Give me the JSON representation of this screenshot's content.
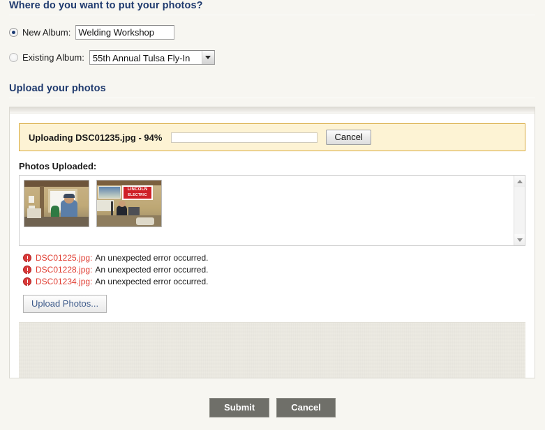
{
  "destination": {
    "heading": "Where do you want to put your photos?",
    "new_album": {
      "label": "New Album:",
      "selected": true,
      "value": "Welding Workshop",
      "placeholder": ""
    },
    "existing_album": {
      "label": "Existing Album:",
      "selected": false,
      "selected_option": "55th Annual Tulsa Fly-In"
    }
  },
  "upload": {
    "heading": "Upload your photos",
    "notice": {
      "text": "Uploading DSC01235.jpg - 94%",
      "percent": 94,
      "fill_color": "#1a9ad8",
      "background_color": "#fdf3d4",
      "border_color": "#d8a93a",
      "cancel_label": "Cancel"
    },
    "photos_uploaded_label": "Photos Uploaded:",
    "thumbnails": [
      {
        "name": "thumbnail-welder-window"
      },
      {
        "name": "thumbnail-lincoln-electric-banner"
      }
    ],
    "thumbnail_2_banner_line1": "LINCOLN",
    "thumbnail_2_banner_line2": "ELECTRIC",
    "errors": [
      {
        "file": "DSC01225.jpg:",
        "message": "An unexpected error occurred."
      },
      {
        "file": "DSC01228.jpg:",
        "message": "An unexpected error occurred."
      },
      {
        "file": "DSC01234.jpg:",
        "message": "An unexpected error occurred."
      }
    ],
    "error_color": "#e03c31",
    "upload_photos_label": "Upload Photos..."
  },
  "footer": {
    "submit_label": "Submit",
    "cancel_label": "Cancel"
  }
}
